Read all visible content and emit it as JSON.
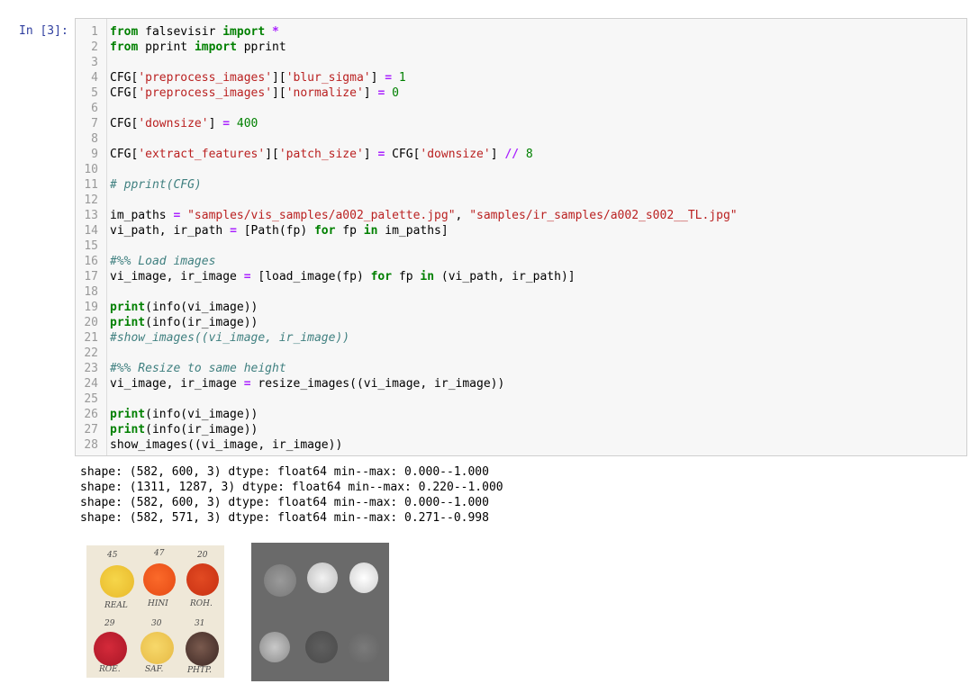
{
  "prompt": "In [3]:",
  "code_lines": [
    {
      "n": "1",
      "tokens": [
        [
          "kw",
          "from"
        ],
        [
          "t",
          " falsevisir "
        ],
        [
          "kw",
          "import"
        ],
        [
          "t",
          " "
        ],
        [
          "op",
          "*"
        ]
      ]
    },
    {
      "n": "2",
      "tokens": [
        [
          "kw",
          "from"
        ],
        [
          "t",
          " pprint "
        ],
        [
          "kw",
          "import"
        ],
        [
          "t",
          " pprint"
        ]
      ]
    },
    {
      "n": "3",
      "tokens": []
    },
    {
      "n": "4",
      "tokens": [
        [
          "t",
          "CFG["
        ],
        [
          "str",
          "'preprocess_images'"
        ],
        [
          "t",
          "]["
        ],
        [
          "str",
          "'blur_sigma'"
        ],
        [
          "t",
          "] "
        ],
        [
          "op",
          "="
        ],
        [
          "t",
          " "
        ],
        [
          "num",
          "1"
        ]
      ]
    },
    {
      "n": "5",
      "tokens": [
        [
          "t",
          "CFG["
        ],
        [
          "str",
          "'preprocess_images'"
        ],
        [
          "t",
          "]["
        ],
        [
          "str",
          "'normalize'"
        ],
        [
          "t",
          "] "
        ],
        [
          "op",
          "="
        ],
        [
          "t",
          " "
        ],
        [
          "num",
          "0"
        ]
      ]
    },
    {
      "n": "6",
      "tokens": []
    },
    {
      "n": "7",
      "tokens": [
        [
          "t",
          "CFG["
        ],
        [
          "str",
          "'downsize'"
        ],
        [
          "t",
          "] "
        ],
        [
          "op",
          "="
        ],
        [
          "t",
          " "
        ],
        [
          "num",
          "400"
        ]
      ]
    },
    {
      "n": "8",
      "tokens": []
    },
    {
      "n": "9",
      "tokens": [
        [
          "t",
          "CFG["
        ],
        [
          "str",
          "'extract_features'"
        ],
        [
          "t",
          "]["
        ],
        [
          "str",
          "'patch_size'"
        ],
        [
          "t",
          "] "
        ],
        [
          "op",
          "="
        ],
        [
          "t",
          " CFG["
        ],
        [
          "str",
          "'downsize'"
        ],
        [
          "t",
          "] "
        ],
        [
          "op",
          "//"
        ],
        [
          "t",
          " "
        ],
        [
          "num",
          "8"
        ]
      ]
    },
    {
      "n": "10",
      "tokens": []
    },
    {
      "n": "11",
      "tokens": [
        [
          "com",
          "# pprint(CFG)"
        ]
      ]
    },
    {
      "n": "12",
      "tokens": []
    },
    {
      "n": "13",
      "tokens": [
        [
          "t",
          "im_paths "
        ],
        [
          "op",
          "="
        ],
        [
          "t",
          " "
        ],
        [
          "str",
          "\"samples/vis_samples/a002_palette.jpg\""
        ],
        [
          "t",
          ", "
        ],
        [
          "str",
          "\"samples/ir_samples/a002_s002__TL.jpg\""
        ]
      ]
    },
    {
      "n": "14",
      "tokens": [
        [
          "t",
          "vi_path, ir_path "
        ],
        [
          "op",
          "="
        ],
        [
          "t",
          " [Path(fp) "
        ],
        [
          "kw",
          "for"
        ],
        [
          "t",
          " fp "
        ],
        [
          "kw",
          "in"
        ],
        [
          "t",
          " im_paths]"
        ]
      ]
    },
    {
      "n": "15",
      "tokens": []
    },
    {
      "n": "16",
      "tokens": [
        [
          "com",
          "#%% Load images"
        ]
      ]
    },
    {
      "n": "17",
      "tokens": [
        [
          "t",
          "vi_image, ir_image "
        ],
        [
          "op",
          "="
        ],
        [
          "t",
          " [load_image(fp) "
        ],
        [
          "kw",
          "for"
        ],
        [
          "t",
          " fp "
        ],
        [
          "kw",
          "in"
        ],
        [
          "t",
          " (vi_path, ir_path)]"
        ]
      ]
    },
    {
      "n": "18",
      "tokens": []
    },
    {
      "n": "19",
      "tokens": [
        [
          "kw2",
          "print"
        ],
        [
          "t",
          "(info(vi_image))"
        ]
      ]
    },
    {
      "n": "20",
      "tokens": [
        [
          "kw2",
          "print"
        ],
        [
          "t",
          "(info(ir_image))"
        ]
      ]
    },
    {
      "n": "21",
      "tokens": [
        [
          "com",
          "#show_images((vi_image, ir_image))"
        ]
      ]
    },
    {
      "n": "22",
      "tokens": []
    },
    {
      "n": "23",
      "tokens": [
        [
          "com",
          "#%% Resize to same height"
        ]
      ]
    },
    {
      "n": "24",
      "tokens": [
        [
          "t",
          "vi_image, ir_image "
        ],
        [
          "op",
          "="
        ],
        [
          "t",
          " resize_images((vi_image, ir_image))"
        ]
      ]
    },
    {
      "n": "25",
      "tokens": []
    },
    {
      "n": "26",
      "tokens": [
        [
          "kw2",
          "print"
        ],
        [
          "t",
          "(info(vi_image))"
        ]
      ]
    },
    {
      "n": "27",
      "tokens": [
        [
          "kw2",
          "print"
        ],
        [
          "t",
          "(info(ir_image))"
        ]
      ]
    },
    {
      "n": "28",
      "tokens": [
        [
          "t",
          "show_images((vi_image, ir_image))"
        ]
      ]
    }
  ],
  "output_lines": [
    "shape: (582, 600, 3) dtype: float64 min--max: 0.000--1.000",
    "shape: (1311, 1287, 3) dtype: float64 min--max: 0.220--1.000",
    "shape: (582, 600, 3) dtype: float64 min--max: 0.000--1.000",
    "shape: (582, 571, 3) dtype: float64 min--max: 0.271--0.998"
  ],
  "images": {
    "vis": {
      "labels_top": [
        "45",
        "47",
        "20"
      ],
      "labels_mid": [
        "REAL",
        "HINI",
        "ROH."
      ],
      "labels_row2": [
        "29",
        "30",
        "31"
      ],
      "labels_bot": [
        "ROE.",
        "SAF.",
        "PHTP."
      ]
    }
  },
  "colors": {
    "keyword": "#008000",
    "operator": "#aa22ff",
    "string": "#ba2121",
    "comment": "#408080",
    "prompt": "#303f9f"
  }
}
